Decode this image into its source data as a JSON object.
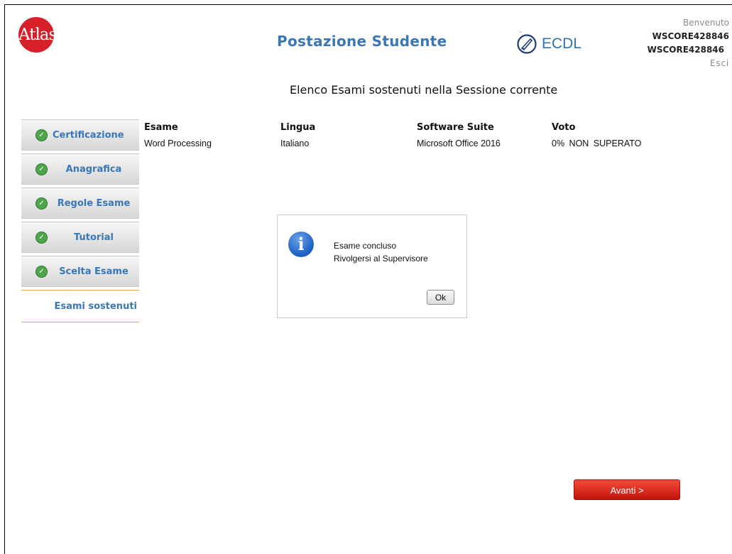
{
  "header": {
    "logo_text": "Atlas",
    "title": "Postazione Studente",
    "ecdl_logo_text": "ECDL",
    "ecdl_tm": "™",
    "welcome": "Benvenuto",
    "user_id": "WSCORE428846",
    "user_id_2": "WSCORE428846",
    "logout": "Esci"
  },
  "page_heading": "Elenco Esami sostenuti nella Sessione corrente",
  "sidebar": {
    "items": [
      {
        "label": "Certificazione",
        "icon": "check-icon"
      },
      {
        "label": "Anagrafica",
        "icon": "check-icon"
      },
      {
        "label": "Regole Esame",
        "icon": "check-icon"
      },
      {
        "label": "Tutorial",
        "icon": "check-icon"
      },
      {
        "label": "Scelta Esame",
        "icon": "check-icon"
      }
    ],
    "active_label": "Esami sostenuti"
  },
  "table": {
    "headers": [
      "Esame",
      "Lingua",
      "Software Suite",
      "Voto"
    ],
    "rows": [
      [
        "Word Processing",
        "Italiano",
        "Microsoft Office 2016",
        "0% NON SUPERATO"
      ]
    ]
  },
  "dialog": {
    "icon": "info-icon",
    "line1": "Esame concluso",
    "line2": "Rivolgersi al Supervisore",
    "ok_label": "Ok"
  },
  "footer": {
    "next_label": "Avanti >"
  },
  "colors": {
    "accent_blue": "#3b77b4",
    "next_button_red": "#d9261c",
    "active_border_orange": "#f0a44a",
    "check_green": "#4da64a",
    "logo_red": "#d8202a"
  }
}
